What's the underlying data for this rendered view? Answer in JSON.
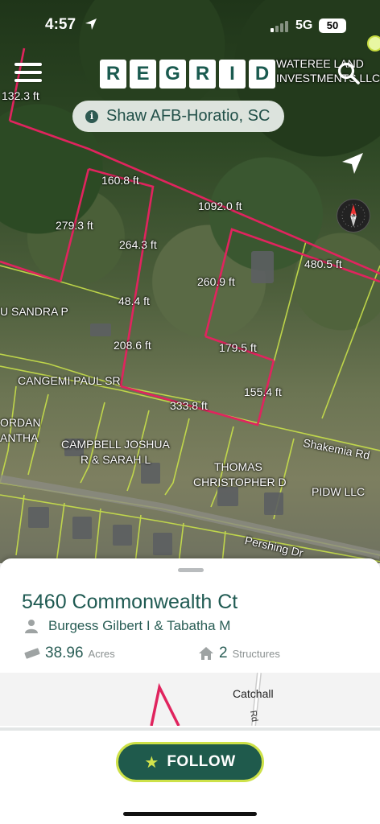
{
  "status_bar": {
    "time": "4:57",
    "network": "5G",
    "battery": "50"
  },
  "app": {
    "logo_letters": [
      "R",
      "E",
      "G",
      "R",
      "I",
      "D"
    ]
  },
  "region": {
    "name": "Shaw AFB-Horatio, SC"
  },
  "map": {
    "labels": [
      {
        "key": "l1",
        "text": "132.3 ft"
      },
      {
        "key": "l2",
        "text": "WATEREE LAND"
      },
      {
        "key": "l3",
        "text": "INVESTMENTS LLC"
      },
      {
        "key": "l4",
        "text": "160.8 ft"
      },
      {
        "key": "l5",
        "text": "1092.0 ft"
      },
      {
        "key": "l6",
        "text": "279.3 ft"
      },
      {
        "key": "l7",
        "text": "264.3 ft"
      },
      {
        "key": "l8",
        "text": "480.5 ft"
      },
      {
        "key": "l9",
        "text": "260.9 ft"
      },
      {
        "key": "l10",
        "text": "U SANDRA P"
      },
      {
        "key": "l11",
        "text": "48.4 ft"
      },
      {
        "key": "l12",
        "text": "208.6 ft"
      },
      {
        "key": "l13",
        "text": "179.5 ft"
      },
      {
        "key": "l14",
        "text": "CANGEMI PAUL SR"
      },
      {
        "key": "l15",
        "text": "155.4 ft"
      },
      {
        "key": "l16",
        "text": "333.8 ft"
      },
      {
        "key": "l17",
        "text": "ORDAN"
      },
      {
        "key": "l18",
        "text": "ANTHA"
      },
      {
        "key": "l19",
        "text": "CAMPBELL JOSHUA"
      },
      {
        "key": "l20",
        "text": "R & SARAH L"
      },
      {
        "key": "l21",
        "text": "Shakemia Rd"
      },
      {
        "key": "l22",
        "text": "THOMAS"
      },
      {
        "key": "l23",
        "text": "CHRISTOPHER D"
      },
      {
        "key": "l24",
        "text": "PIDW LLC"
      },
      {
        "key": "l25",
        "text": "Pershing Dr"
      }
    ]
  },
  "parcel": {
    "address": "5460 Commonwealth Ct",
    "owner": "Burgess Gilbert I & Tabatha M",
    "acres_value": "38.96",
    "acres_unit": "Acres",
    "structures_value": "2",
    "structures_unit": "Structures",
    "minimap_label": "Catchall",
    "minimap_road": "Rd"
  },
  "follow_button": {
    "label": "FOLLOW"
  },
  "colors": {
    "brand": "#1f5a4c",
    "accent": "#cde148",
    "parcel_selected": "#e0245e",
    "parcel_line": "#c8e04a"
  },
  "icons": [
    "location-arrow-icon",
    "cellular-signal-icon",
    "battery-icon",
    "menu-icon",
    "search-icon",
    "info-icon",
    "navigation-arrow-icon",
    "compass-icon",
    "person-icon",
    "ruler-icon",
    "house-icon",
    "star-icon"
  ]
}
